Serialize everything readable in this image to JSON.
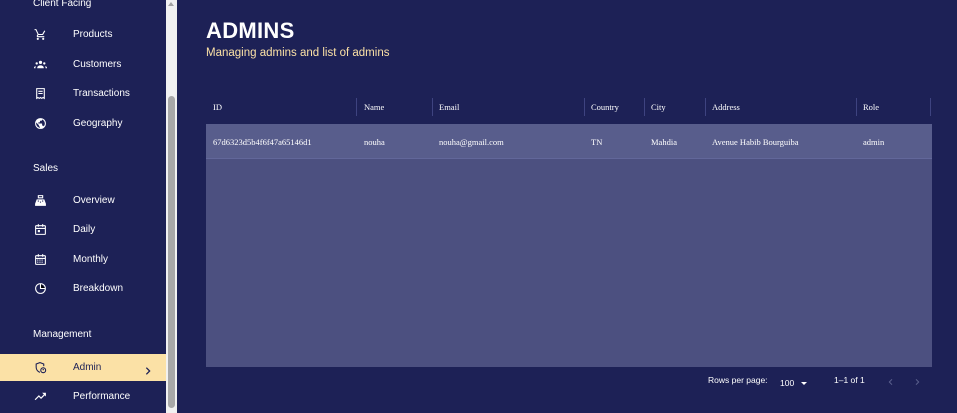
{
  "sidebar": {
    "sections": [
      {
        "title": "Client Facing"
      },
      {
        "title": "Sales"
      },
      {
        "title": "Management"
      }
    ],
    "items": [
      {
        "label": "Products",
        "icon": "shopping-cart-icon"
      },
      {
        "label": "Customers",
        "icon": "groups-icon"
      },
      {
        "label": "Transactions",
        "icon": "receipt-icon"
      },
      {
        "label": "Geography",
        "icon": "globe-icon"
      },
      {
        "label": "Overview",
        "icon": "point-of-sale-icon"
      },
      {
        "label": "Daily",
        "icon": "today-calendar-icon"
      },
      {
        "label": "Monthly",
        "icon": "calendar-month-icon"
      },
      {
        "label": "Breakdown",
        "icon": "pie-chart-icon"
      },
      {
        "label": "Admin",
        "icon": "admin-panel-icon",
        "active": true
      },
      {
        "label": "Performance",
        "icon": "trending-up-icon"
      }
    ]
  },
  "header": {
    "title": "ADMINS",
    "subtitle": "Managing admins and list of admins"
  },
  "table": {
    "columns": [
      "ID",
      "Name",
      "Email",
      "Country",
      "City",
      "Address",
      "Role"
    ],
    "rows": [
      [
        "67d6323d5b4f6f47a65146d1",
        "nouha",
        "nouha@gmail.com",
        "TN",
        "Mahdia",
        "Avenue Habib Bourguiba",
        "admin"
      ]
    ]
  },
  "footer": {
    "rows_per_page_label": "Rows per page:",
    "rows_per_page_value": "100",
    "range_text": "1–1 of 1"
  },
  "colors": {
    "background": "#1d2156",
    "accent": "#fbe1a6",
    "grid_body": "#4c5080",
    "row": "#585d8c"
  }
}
